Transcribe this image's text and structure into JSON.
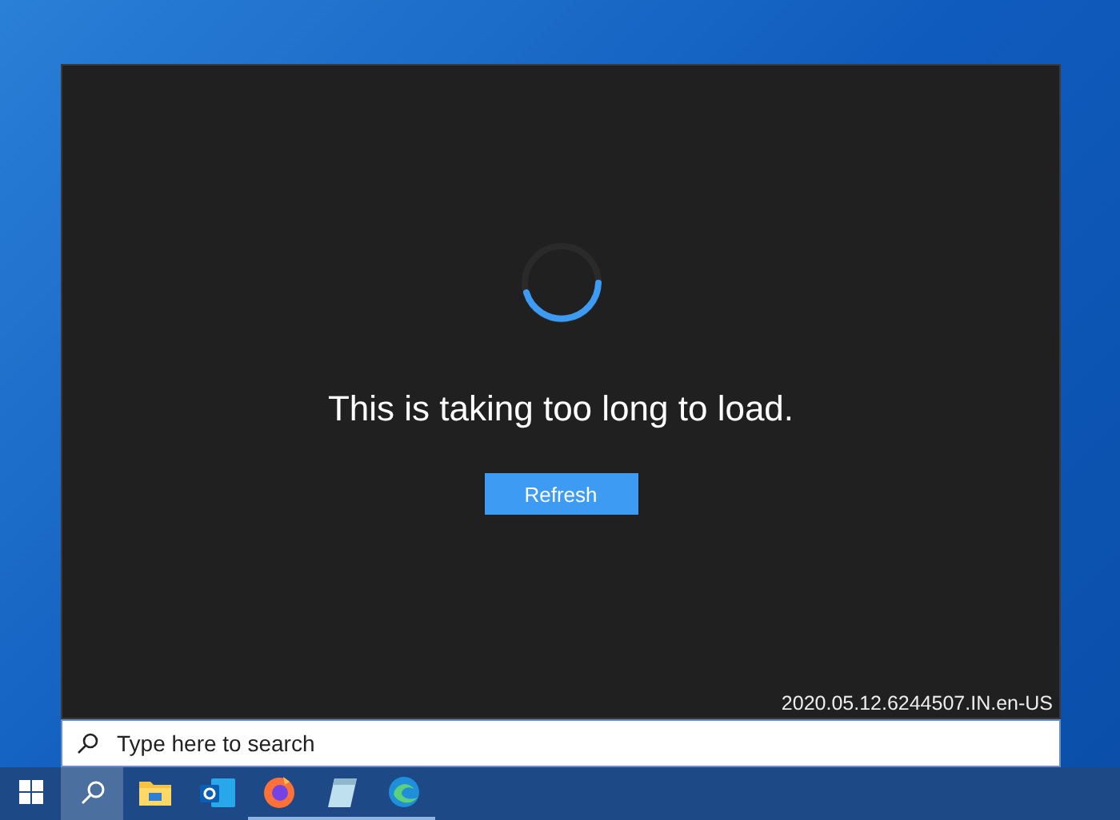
{
  "dialog": {
    "message": "This is taking too long to load.",
    "button": "Refresh",
    "version": "2020.05.12.6244507.IN.en-US"
  },
  "search": {
    "placeholder": "Type here to search"
  },
  "taskbar": {
    "items": [
      {
        "kind": "start",
        "selected": false,
        "running": false
      },
      {
        "kind": "search",
        "selected": true,
        "running": false
      },
      {
        "kind": "folder",
        "selected": false,
        "running": false
      },
      {
        "kind": "mail",
        "selected": false,
        "running": false
      },
      {
        "kind": "fox",
        "selected": false,
        "running": true
      },
      {
        "kind": "notepad",
        "selected": false,
        "running": true
      },
      {
        "kind": "wave",
        "selected": false,
        "running": true
      }
    ]
  }
}
